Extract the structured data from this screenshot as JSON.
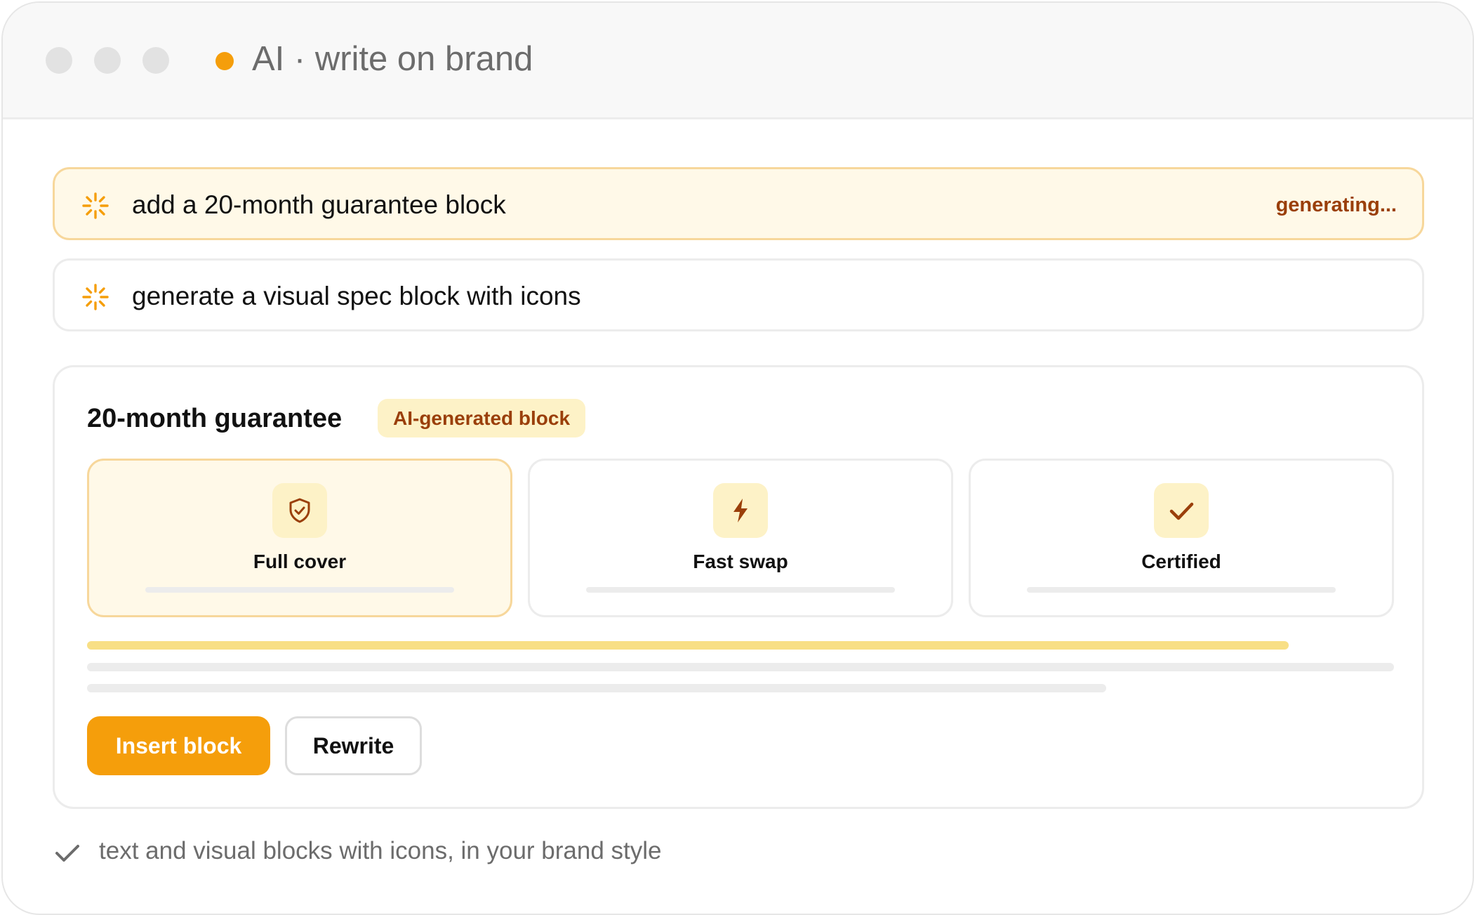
{
  "window": {
    "title": "AI · write on brand",
    "status_color": "#f59e0b"
  },
  "prompts": [
    {
      "text": "add a 20-month guarantee block",
      "status": "generating...",
      "icon": "sparkle-icon"
    },
    {
      "text": "generate a visual spec block with icons",
      "icon": "sparkle-icon"
    }
  ],
  "block": {
    "title": "20-month guarantee",
    "badge": "AI-generated block",
    "features": [
      {
        "label": "Full cover",
        "icon": "shield-check-icon"
      },
      {
        "label": "Fast swap",
        "icon": "lightning-icon"
      },
      {
        "label": "Certified",
        "icon": "checkmark-icon"
      }
    ],
    "actions": {
      "insert": "Insert block",
      "rewrite": "Rewrite"
    }
  },
  "footer": {
    "text": "text and visual blocks with icons, in your brand style",
    "icon": "checkmark-icon"
  },
  "colors": {
    "accent": "#f59e0b",
    "accent_dark": "#9a3f0a",
    "highlight_bg": "#fff9e8",
    "highlight_border": "#f7d79b",
    "badge_bg": "#fdf2c7",
    "progress_bar": "#f8df85"
  }
}
